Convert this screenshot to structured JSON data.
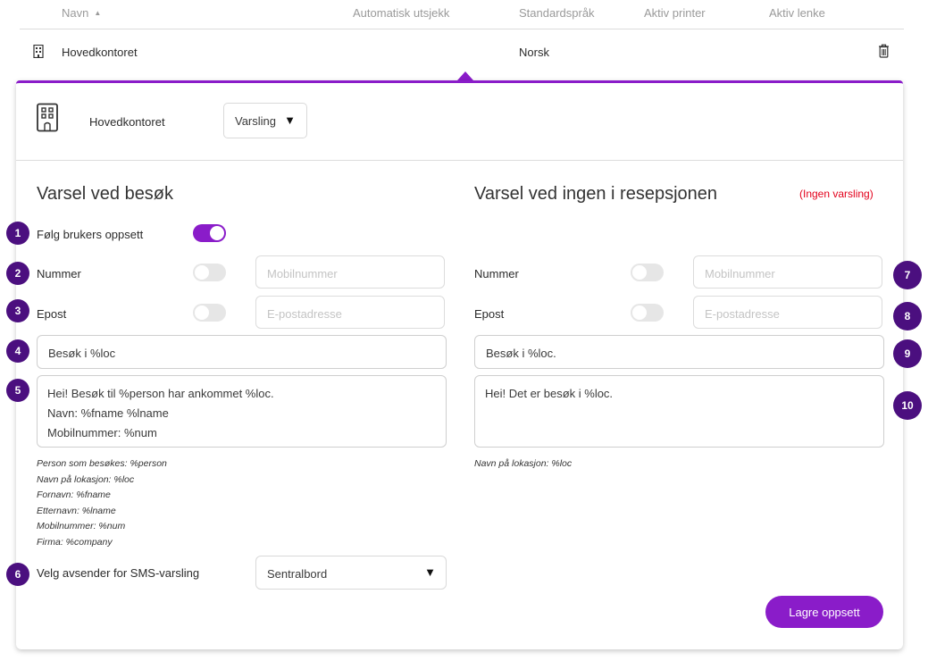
{
  "table": {
    "headers": {
      "name": "Navn",
      "auto_checkout": "Automatisk utsjekk",
      "language": "Standardspråk",
      "printer": "Aktiv printer",
      "link": "Aktiv lenke"
    },
    "sort_indicator": "▲",
    "rows": [
      {
        "name": "Hovedkontoret",
        "language": "Norsk"
      }
    ]
  },
  "panel": {
    "location_name": "Hovedkontoret",
    "section_select": "Varsling",
    "left": {
      "title": "Varsel ved besøk",
      "follow_user_label": "Følg brukers oppsett",
      "follow_user_on": true,
      "number_label": "Nummer",
      "number_placeholder": "Mobilnummer",
      "email_label": "Epost",
      "email_placeholder": "E-postadresse",
      "subject": "Besøk i %loc",
      "message_lines": [
        "Hei! Besøk til %person har ankommet %loc.",
        "Navn: %fname %lname",
        "Mobilnummer: %num"
      ],
      "help_lines": [
        "Person som besøkes: %person",
        "Navn på lokasjon: %loc",
        "Fornavn: %fname",
        "Etternavn: %lname",
        "Mobilnummer: %num",
        "Firma: %company"
      ],
      "sms_sender_label": "Velg avsender for SMS-varsling",
      "sms_sender_value": "Sentralbord"
    },
    "right": {
      "title": "Varsel ved ingen i resepsjonen",
      "status": "(Ingen varsling)",
      "number_label": "Nummer",
      "number_placeholder": "Mobilnummer",
      "email_label": "Epost",
      "email_placeholder": "E-postadresse",
      "subject": "Besøk i %loc.",
      "message_lines": [
        "Hei! Det er besøk i %loc."
      ],
      "help_lines": [
        "Navn på lokasjon: %loc"
      ]
    },
    "save_label": "Lagre oppsett"
  },
  "badges": [
    "1",
    "2",
    "3",
    "4",
    "5",
    "6",
    "7",
    "8",
    "9",
    "10"
  ],
  "colors": {
    "accent": "#8a1cc9",
    "badge": "#4b0f7f",
    "warning": "#e3001b"
  }
}
